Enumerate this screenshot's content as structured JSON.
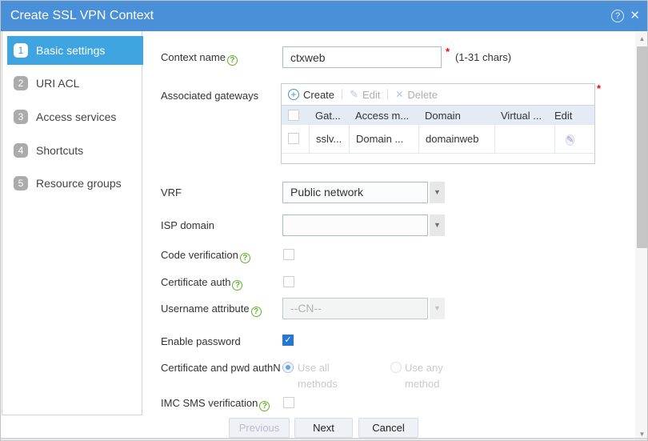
{
  "titlebar": {
    "title": "Create SSL VPN Context"
  },
  "icons": {
    "help": "?",
    "close": "✕",
    "plus": "+",
    "pencil": "✎",
    "cross": "✕",
    "dropdown_arrow": "▼",
    "check": "✓",
    "scroll_up": "▲",
    "scroll_down": "▼",
    "qmark": "?"
  },
  "colors": {
    "titlebar_blue": "#4a90d9",
    "active_step_blue": "#3fa5e1",
    "checked_blue": "#2577d2",
    "help_green": "#63b02a",
    "required_red": "#ff0000",
    "table_header_bg": "#e5ebf4"
  },
  "sidebar": {
    "items": [
      {
        "num": "1",
        "label": "Basic settings",
        "active": true
      },
      {
        "num": "2",
        "label": "URI ACL",
        "active": false
      },
      {
        "num": "3",
        "label": "Access services",
        "active": false
      },
      {
        "num": "4",
        "label": "Shortcuts",
        "active": false
      },
      {
        "num": "5",
        "label": "Resource groups",
        "active": false
      }
    ]
  },
  "form": {
    "context_name": {
      "label": "Context name",
      "value": "ctxweb",
      "required": "*",
      "hint": "(1-31 chars)"
    },
    "associated_gateways": {
      "label": "Associated gateways",
      "required": "*",
      "toolbar": {
        "create": "Create",
        "edit": "Edit",
        "delete": "Delete"
      },
      "columns": [
        "",
        "Gat...",
        "Access m...",
        "Domain",
        "Virtual ...",
        "Edit"
      ],
      "rows": [
        {
          "gateway": "sslv...",
          "access_mode": "Domain ...",
          "domain": "domainweb",
          "virtual_host": ""
        }
      ]
    },
    "vrf": {
      "label": "VRF",
      "value": "Public network"
    },
    "isp_domain": {
      "label": "ISP domain",
      "value": ""
    },
    "code_verification": {
      "label": "Code verification",
      "checked": false
    },
    "certificate_auth": {
      "label": "Certificate auth",
      "checked": false
    },
    "username_attribute": {
      "label": "Username attribute",
      "value": "--CN--",
      "disabled": true
    },
    "enable_password": {
      "label": "Enable password",
      "checked": true
    },
    "cert_pwd_authn": {
      "label": "Certificate and pwd authN",
      "options": [
        {
          "label": "Use all methods",
          "selected": true
        },
        {
          "label": "Use any method",
          "selected": false
        }
      ]
    },
    "imc_sms": {
      "label": "IMC SMS verification",
      "checked": false
    }
  },
  "footer": {
    "previous": "Previous",
    "next": "Next",
    "cancel": "Cancel",
    "previous_disabled": true
  }
}
